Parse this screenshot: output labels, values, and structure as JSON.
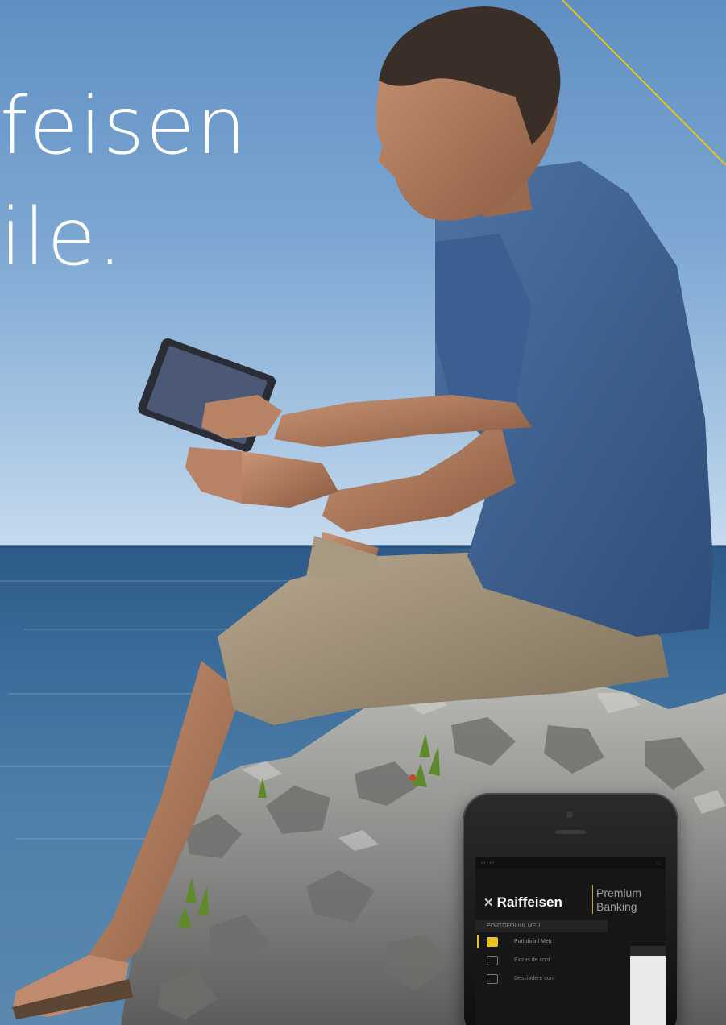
{
  "headline": {
    "line1": "feisen",
    "line2": "ile."
  },
  "colors": {
    "accent": "#e8c51a",
    "sky": "#7ea8d3",
    "sea": "#3b6c9a",
    "shirt": "#3d5f8c",
    "shorts": "#a3937a"
  },
  "phone_app": {
    "brand": "Raiffeisen",
    "brand_icon": "x-logo-icon",
    "premium_line1": "Premium",
    "premium_line2": "Banking",
    "section_label": "PORTOFOLIUL MEU",
    "menu": [
      {
        "label": "Portofoliul Meu",
        "icon": "wallet-icon",
        "active": true
      },
      {
        "label": "Extras de cont",
        "icon": "statement-icon",
        "active": false
      },
      {
        "label": "Deschidere cont",
        "icon": "open-account-icon",
        "active": false
      }
    ]
  }
}
